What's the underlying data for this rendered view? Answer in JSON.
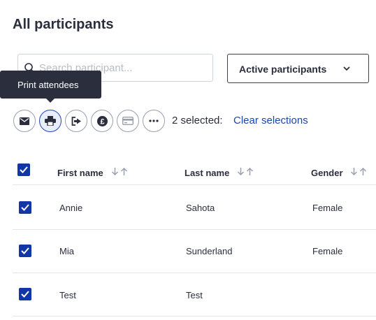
{
  "page": {
    "title": "All participants"
  },
  "search": {
    "placeholder": "Search participant..."
  },
  "filter": {
    "label": "Active participants"
  },
  "tooltip": {
    "text": "Print attendees"
  },
  "actions": [
    {
      "name": "email",
      "icon": "envelope-icon"
    },
    {
      "name": "print",
      "icon": "printer-icon",
      "active": true
    },
    {
      "name": "export",
      "icon": "sign-out-icon"
    },
    {
      "name": "payment",
      "icon": "pound-coin-icon"
    },
    {
      "name": "card",
      "icon": "credit-card-icon"
    },
    {
      "name": "more",
      "icon": "ellipsis-icon"
    }
  ],
  "selection": {
    "count_text": "2 selected:",
    "clear_label": "Clear selections"
  },
  "table": {
    "columns": [
      {
        "label": "First name"
      },
      {
        "label": "Last name"
      },
      {
        "label": "Gender"
      }
    ],
    "rows": [
      {
        "first": "Annie",
        "last": "Sahota",
        "gender": "Female",
        "checked": true
      },
      {
        "first": "Mia",
        "last": "Sunderland",
        "gender": "Female",
        "checked": true
      },
      {
        "first": "Test",
        "last": "Test",
        "gender": "",
        "checked": true
      }
    ]
  },
  "colors": {
    "accent": "#1236a6",
    "link": "#1a46b0",
    "tooltip_bg": "#2a2e3d"
  }
}
